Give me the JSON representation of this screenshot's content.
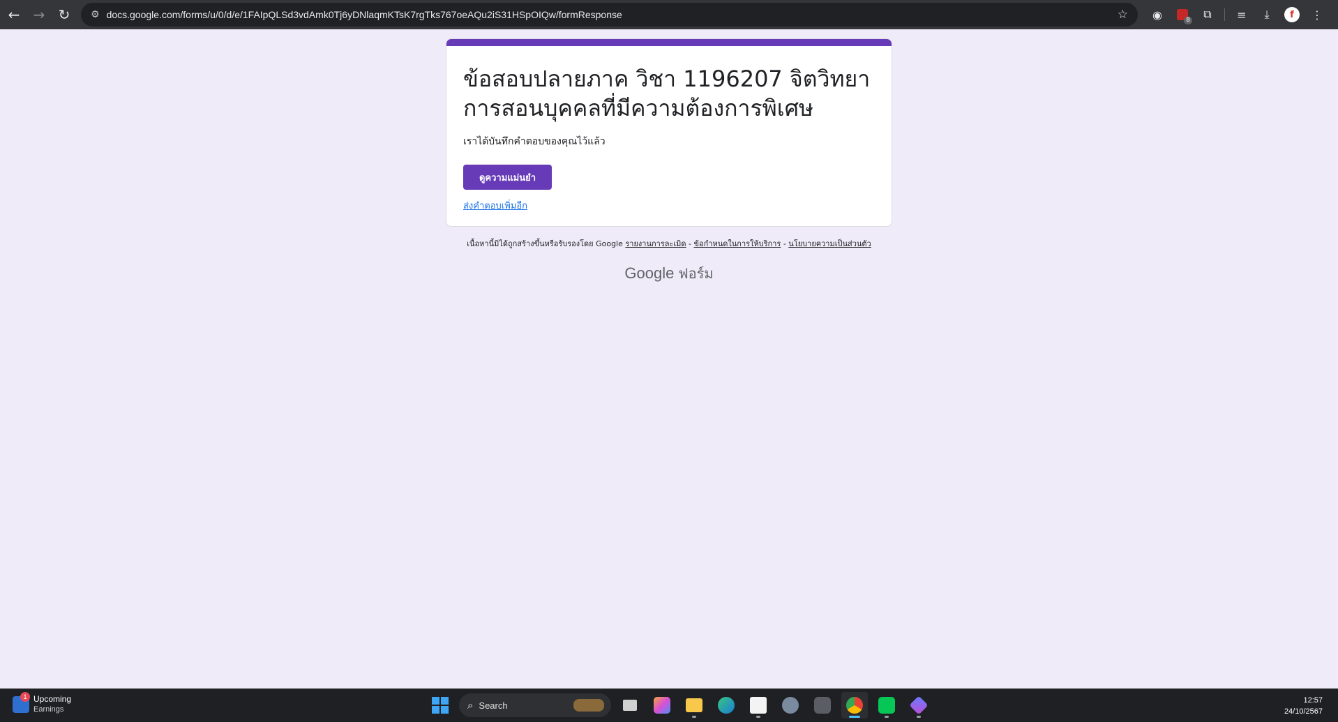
{
  "browser": {
    "url": "docs.google.com/forms/u/0/d/e/1FAIpQLSd3vdAmk0Tj6yDNlaqmKTsK7rgTks767oeAQu2iS31HSpOIQw/formResponse",
    "extension_badge_count": "8",
    "profile_initial": "f"
  },
  "form": {
    "title": "ข้อสอบปลายภาค วิชา 1196207 จิตวิทยาการสอนบุคคลที่มีความต้องการพิเศษ",
    "message": "เราได้บันทึกคำตอบของคุณไว้แล้ว",
    "view_score_label": "ดูความแม่นยำ",
    "submit_another_label": "ส่งคำตอบเพิ่มอีก",
    "accent_color": "#673ab7"
  },
  "footer": {
    "disclaimer": "เนื้อหานี้มิได้ถูกสร้างขึ้นหรือรับรองโดย Google",
    "report_abuse": "รายงานการละเมิด",
    "sep": "-",
    "terms": "ข้อกำหนดในการให้บริการ",
    "privacy": "นโยบายความเป็นส่วนตัว",
    "logo_google": "Google",
    "logo_forms": "ฟอร์ม"
  },
  "taskbar": {
    "widget_badge": "1",
    "widget_title": "Upcoming",
    "widget_subtitle": "Earnings",
    "search_label": "Search",
    "time": "12:57",
    "date": "24/10/2567"
  }
}
